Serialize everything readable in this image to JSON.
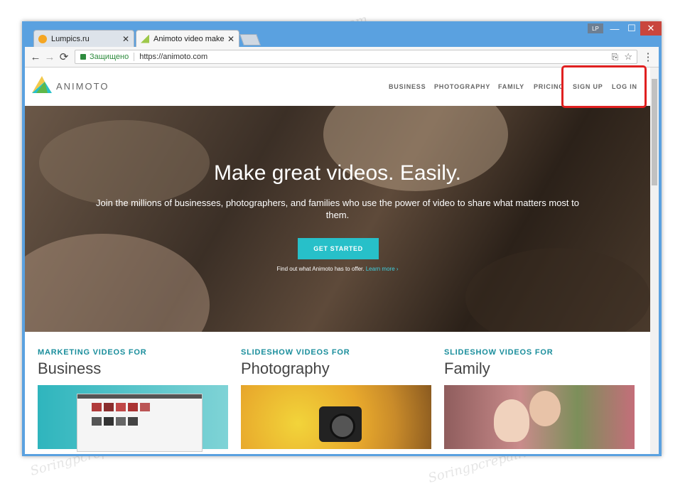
{
  "browser": {
    "tabs": [
      {
        "title": "Lumpics.ru",
        "close": "✕",
        "favicon_color": "#f5a623"
      },
      {
        "title": "Animoto video maker - S",
        "close": "✕",
        "favicon_color": "#9ec84a"
      }
    ],
    "profile_badge": "LP",
    "window_controls": {
      "minimize": "—",
      "maximize": "☐",
      "close": "✕"
    },
    "nav": {
      "back": "←",
      "forward": "→",
      "reload": "⟳"
    },
    "address": {
      "secure_label": "Защищено",
      "url": "https://animoto.com"
    },
    "actions": {
      "translate": "⎘",
      "bookmark": "☆",
      "menu": "⋮"
    }
  },
  "site": {
    "logo_text": "ANIMOTO",
    "nav": [
      "BUSINESS",
      "PHOTOGRAPHY",
      "FAMILY",
      "PRICING",
      "SIGN UP",
      "LOG IN"
    ],
    "hero": {
      "title": "Make great videos. Easily.",
      "subtitle": "Join the millions of businesses, photographers, and families who use the power of video to share what matters most to them.",
      "cta": "GET STARTED",
      "note": "Find out what Animoto has to offer.",
      "learn_more": "Learn more ›"
    },
    "columns": [
      {
        "kicker": "MARKETING VIDEOS FOR",
        "heading": "Business"
      },
      {
        "kicker": "SLIDESHOW VIDEOS FOR",
        "heading": "Photography"
      },
      {
        "kicker": "SLIDESHOW VIDEOS FOR",
        "heading": "Family"
      }
    ]
  },
  "watermark": "Soringpcrepair.com",
  "colors": {
    "accent": "#27c0c9",
    "kicker": "#1a8e9c",
    "highlight": "#e02020",
    "window": "#5aa1e0"
  }
}
